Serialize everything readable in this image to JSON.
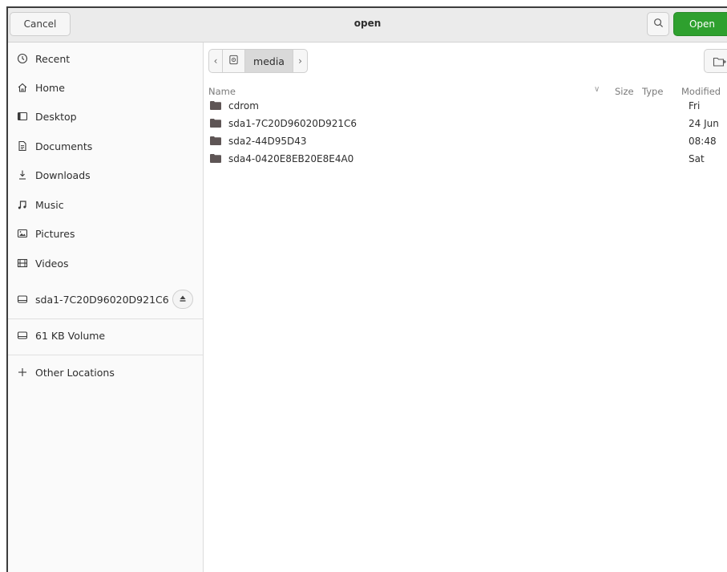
{
  "header": {
    "cancel_label": "Cancel",
    "title": "open",
    "open_label": "Open",
    "search_icon": "search-icon",
    "open_color": "#2ea02e"
  },
  "sidebar": {
    "items": [
      {
        "label": "Recent",
        "icon": "clock-icon"
      },
      {
        "label": "Home",
        "icon": "home-icon"
      },
      {
        "label": "Desktop",
        "icon": "desktop-icon"
      },
      {
        "label": "Documents",
        "icon": "document-icon"
      },
      {
        "label": "Downloads",
        "icon": "download-icon"
      },
      {
        "label": "Music",
        "icon": "music-note-icon"
      },
      {
        "label": "Pictures",
        "icon": "picture-icon"
      },
      {
        "label": "Videos",
        "icon": "film-icon"
      },
      {
        "label": "sda1-7C20D96020D921C6",
        "icon": "drive-icon"
      }
    ],
    "volume": {
      "label": "61 KB Volume",
      "icon": "drive-icon"
    },
    "other": {
      "label": "Other Locations",
      "icon": "plus-icon"
    }
  },
  "pathbar": {
    "current": "media"
  },
  "columns": {
    "name": "Name",
    "size": "Size",
    "type": "Type",
    "modified": "Modified"
  },
  "files": [
    {
      "name": "cdrom",
      "modified": "Fri"
    },
    {
      "name": "sda1-7C20D96020D921C6",
      "modified": "24 Jun"
    },
    {
      "name": "sda2-44D95D43",
      "modified": "08:48"
    },
    {
      "name": "sda4-0420E8EB20E8E4A0",
      "modified": "Sat"
    }
  ],
  "colors": {
    "folder": "#5e5555",
    "accent": "#2ea02e"
  }
}
